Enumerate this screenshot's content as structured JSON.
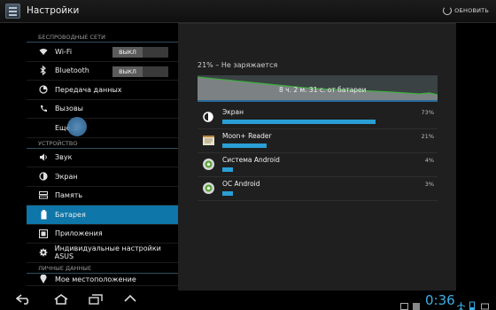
{
  "app": {
    "title": "Настройки",
    "refresh_label": "ОБНОВИТЬ"
  },
  "sidebar": {
    "sections": [
      {
        "header": "БЕСПРОВОДНЫЕ СЕТИ",
        "items": [
          {
            "label": "Wi-Fi",
            "icon": "wifi-icon",
            "toggle": "ВЫКЛ"
          },
          {
            "label": "Bluetooth",
            "icon": "bluetooth-icon",
            "toggle": "ВЫКЛ"
          },
          {
            "label": "Передача данных",
            "icon": "data-usage-icon"
          },
          {
            "label": "Вызовы",
            "icon": "phone-icon"
          },
          {
            "label": "Ещё…",
            "icon": ""
          }
        ]
      },
      {
        "header": "УСТРОЙСТВО",
        "items": [
          {
            "label": "Звук",
            "icon": "speaker-icon"
          },
          {
            "label": "Экран",
            "icon": "brightness-icon"
          },
          {
            "label": "Память",
            "icon": "storage-icon"
          },
          {
            "label": "Батарея",
            "icon": "battery-icon",
            "selected": true
          },
          {
            "label": "Приложения",
            "icon": "apps-icon"
          },
          {
            "label": "Индивидуальные настройки ASUS",
            "icon": "asus-settings-icon"
          }
        ]
      },
      {
        "header": "ЛИЧНЫЕ ДАННЫЕ",
        "items": [
          {
            "label": "Мое местоположение",
            "icon": "location-icon"
          }
        ]
      }
    ]
  },
  "battery": {
    "status": "21% – Не заряжается",
    "graph_label": "8 ч. 2 м. 31 с. от батареи",
    "usage": [
      {
        "name": "Экран",
        "percent_label": "73%",
        "value": 73,
        "icon": "brightness-icon"
      },
      {
        "name": "Moon+ Reader",
        "percent_label": "21%",
        "value": 21,
        "icon": "book-icon"
      },
      {
        "name": "Система Android",
        "percent_label": "4%",
        "value": 4,
        "icon": "android-system-icon"
      },
      {
        "name": "ОС Android",
        "percent_label": "3%",
        "value": 3,
        "icon": "android-os-icon"
      }
    ]
  },
  "navbar": {
    "clock": "0:36"
  },
  "watermark": "",
  "colors": {
    "accent": "#0e76a8",
    "bar": "#2a9fd6",
    "clock": "#3ab0e8",
    "graph_line": "#3faf3f"
  }
}
